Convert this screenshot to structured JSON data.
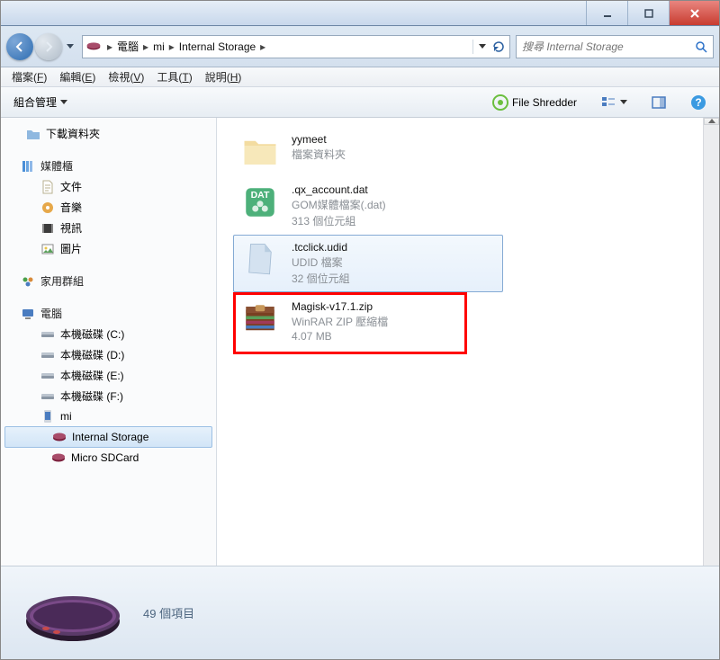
{
  "titlebar": {},
  "breadcrumb": {
    "seg1": "電腦",
    "seg2": "mi",
    "seg3": "Internal Storage"
  },
  "search": {
    "placeholder": "搜尋 Internal Storage"
  },
  "menu": {
    "file": "檔案(F)",
    "edit": "編輯(E)",
    "view": "檢視(V)",
    "tools": "工具(T)",
    "help": "說明(H)"
  },
  "toolbar": {
    "organize": "組合管理",
    "file_shredder": "File Shredder"
  },
  "sidebar": {
    "downloads": "下載資料夾",
    "libraries_header": "媒體櫃",
    "libs": {
      "documents": "文件",
      "music": "音樂",
      "videos": "視訊",
      "pictures": "圖片"
    },
    "homegroup_header": "家用群組",
    "computer_header": "電腦",
    "drives": {
      "c": "本機磁碟 (C:)",
      "d": "本機磁碟 (D:)",
      "e": "本機磁碟 (E:)",
      "f": "本機磁碟 (F:)"
    },
    "mi": "mi",
    "internal_storage": "Internal Storage",
    "micro_sd": "Micro SDCard"
  },
  "files": {
    "item0": {
      "name": "yymeet",
      "meta1": "檔案資料夾"
    },
    "item1": {
      "name": ".qx_account.dat",
      "meta1": "GOM媒體檔案(.dat)",
      "meta2": "313 個位元組"
    },
    "item2": {
      "name": ".tcclick.udid",
      "meta1": "UDID 檔案",
      "meta2": "32 個位元組"
    },
    "item3": {
      "name": "Magisk-v17.1.zip",
      "meta1": "WinRAR ZIP 壓縮檔",
      "meta2": "4.07 MB"
    }
  },
  "status": {
    "count": "49 個項目"
  }
}
